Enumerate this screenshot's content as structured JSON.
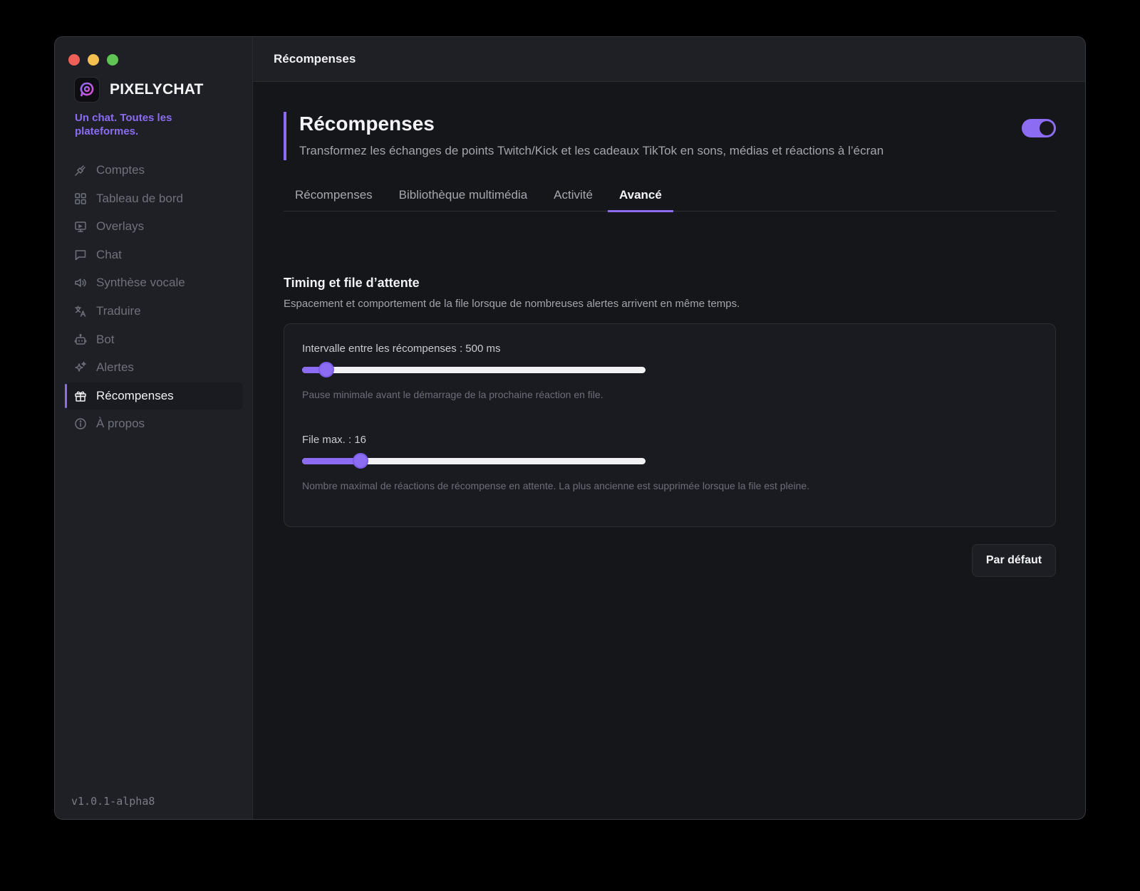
{
  "window": {
    "title": "Récompenses"
  },
  "sidebar": {
    "brand_name": "PIXELYCHAT",
    "tagline": "Un chat. Toutes les plateformes.",
    "version": "v1.0.1-alpha8",
    "items": [
      {
        "label": "Comptes",
        "icon": "plug-icon"
      },
      {
        "label": "Tableau de bord",
        "icon": "dashboard-grid-icon"
      },
      {
        "label": "Overlays",
        "icon": "monitor-icon"
      },
      {
        "label": "Chat",
        "icon": "chat-bubble-icon"
      },
      {
        "label": "Synthèse vocale",
        "icon": "speaker-icon"
      },
      {
        "label": "Traduire",
        "icon": "translate-icon"
      },
      {
        "label": "Bot",
        "icon": "robot-icon"
      },
      {
        "label": "Alertes",
        "icon": "sparkles-icon"
      },
      {
        "label": "Récompenses",
        "icon": "gift-icon",
        "active": true
      },
      {
        "label": "À propos",
        "icon": "info-icon"
      }
    ]
  },
  "header": {
    "title": "Récompenses",
    "description": "Transformez les échanges de points Twitch/Kick et les cadeaux TikTok en sons, médias et réactions à l’écran",
    "enabled": true
  },
  "tabs": [
    {
      "label": "Récompenses"
    },
    {
      "label": "Bibliothèque multimédia"
    },
    {
      "label": "Activité"
    },
    {
      "label": "Avancé",
      "active": true
    }
  ],
  "section": {
    "title": "Timing et file d’attente",
    "description": "Espacement et comportement de la file lorsque de nombreuses alertes arrivent en même temps."
  },
  "fields": {
    "interval": {
      "label": "Intervalle entre les récompenses : 500 ms",
      "value_fraction": 0.07,
      "help": "Pause minimale avant le démarrage de la prochaine réaction en file."
    },
    "queue": {
      "label": "File max. : 16",
      "value_fraction": 0.17,
      "help": "Nombre maximal de réactions de récompense en attente. La plus ancienne est supprimée lorsque la file est pleine."
    }
  },
  "buttons": {
    "reset_label": "Par défaut"
  },
  "colors": {
    "accent": "#8b6cf2",
    "background": "#15161a",
    "sidebar": "#1f2026"
  }
}
